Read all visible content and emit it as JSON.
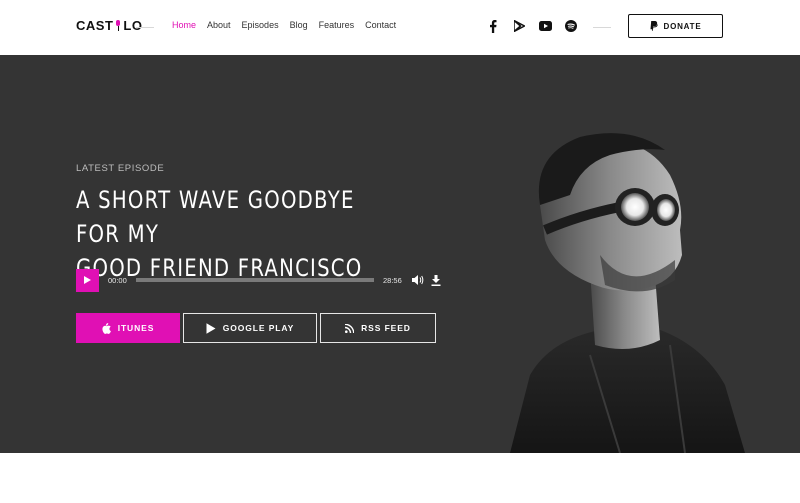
{
  "header": {
    "logo_left": "CAST",
    "logo_right": "LO",
    "nav": [
      {
        "label": "Home",
        "active": true
      },
      {
        "label": "About",
        "active": false
      },
      {
        "label": "Episodes",
        "active": false
      },
      {
        "label": "Blog",
        "active": false
      },
      {
        "label": "Features",
        "active": false
      },
      {
        "label": "Contact",
        "active": false
      }
    ],
    "social_icons": [
      "facebook-icon",
      "google-play-icon",
      "youtube-icon",
      "spotify-icon"
    ],
    "donate_label": "DONATE",
    "donate_icon": "paypal-icon"
  },
  "hero": {
    "eyebrow": "LATEST EPISODE",
    "title_line1": "A SHORT WAVE GOODBYE FOR MY",
    "title_line2": "GOOD FRIEND FRANCISCO",
    "player": {
      "current_time": "00:00",
      "duration": "28:56",
      "progress": 0
    },
    "buttons": {
      "itunes": "ITUNES",
      "google_play": "GOOGLE PLAY",
      "rss": "RSS FEED"
    }
  },
  "colors": {
    "accent": "#e010b4",
    "hero_bg": "#343434",
    "text_dark": "#111111"
  }
}
